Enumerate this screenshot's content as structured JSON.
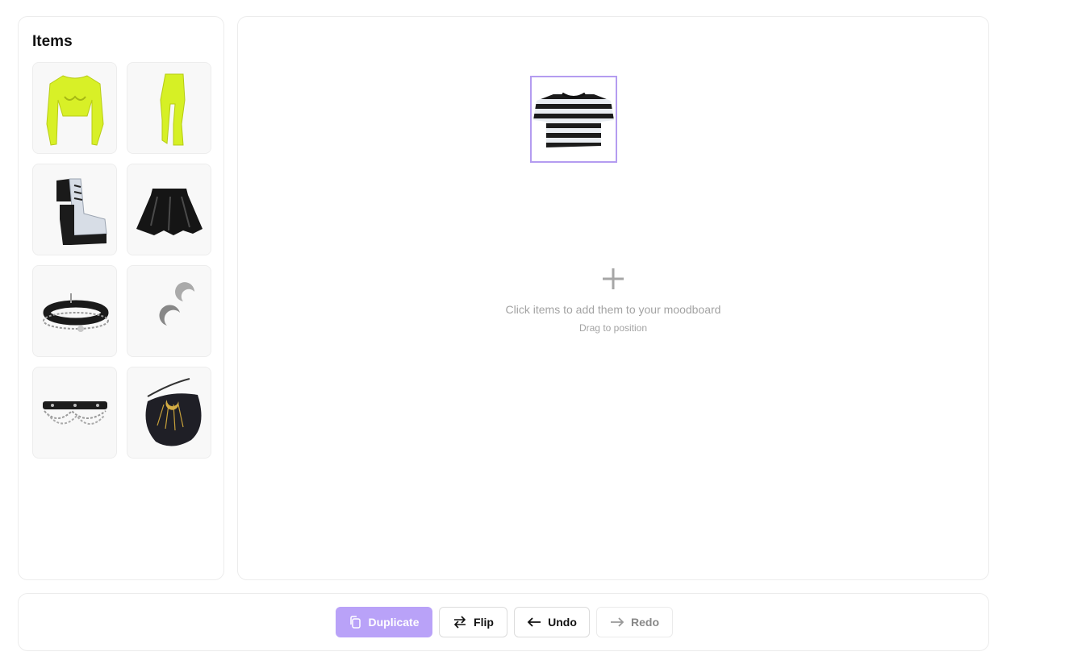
{
  "sidebar": {
    "title": "Items",
    "items": [
      {
        "name": "neon-mesh-top"
      },
      {
        "name": "neon-tights"
      },
      {
        "name": "holographic-platform-boots"
      },
      {
        "name": "black-vinyl-skirt"
      },
      {
        "name": "velvet-choker"
      },
      {
        "name": "moon-earrings"
      },
      {
        "name": "chain-belt"
      },
      {
        "name": "moon-crossbody-bag"
      }
    ]
  },
  "board": {
    "placed_item": "striped-tshirt",
    "hint_text": "Click items to add them to your moodboard",
    "hint_sub": "Drag to position"
  },
  "toolbar": {
    "duplicate_label": "Duplicate",
    "flip_label": "Flip",
    "undo_label": "Undo",
    "redo_label": "Redo"
  },
  "colors": {
    "accent": "#b9a2f8",
    "selection_border": "#b49cf0",
    "border": "#ececec",
    "hint": "#a3a3a3"
  }
}
